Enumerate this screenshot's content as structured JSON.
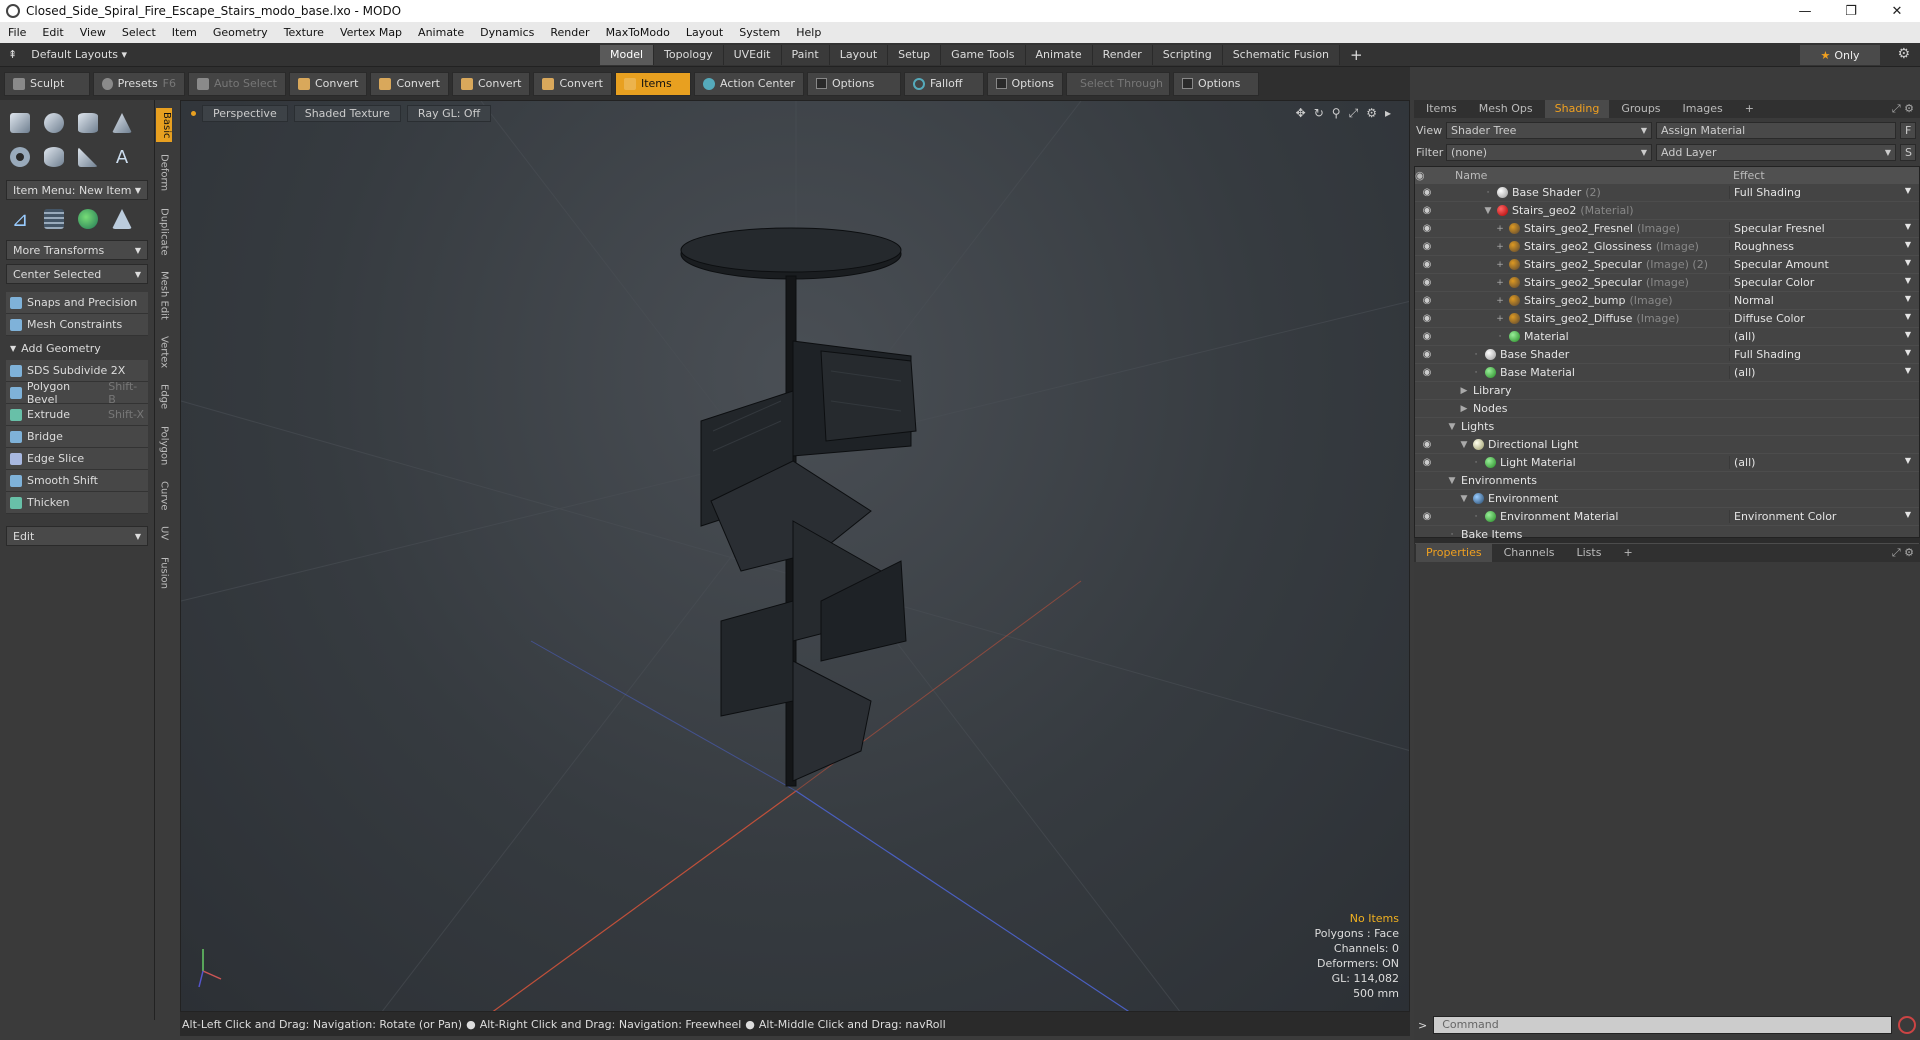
{
  "window": {
    "title": "Closed_Side_Spiral_Fire_Escape_Stairs_modo_base.lxo - MODO",
    "controls": [
      "—",
      "❐",
      "✕"
    ]
  },
  "menu": [
    "File",
    "Edit",
    "View",
    "Select",
    "Item",
    "Geometry",
    "Texture",
    "Vertex Map",
    "Animate",
    "Dynamics",
    "Render",
    "MaxToModo",
    "Layout",
    "System",
    "Help"
  ],
  "layouts": {
    "label": "Default Layouts"
  },
  "tabs": [
    {
      "label": "Model",
      "active": true
    },
    {
      "label": "Topology"
    },
    {
      "label": "UVEdit"
    },
    {
      "label": "Paint"
    },
    {
      "label": "Layout"
    },
    {
      "label": "Setup"
    },
    {
      "label": "Game Tools"
    },
    {
      "label": "Animate"
    },
    {
      "label": "Render"
    },
    {
      "label": "Scripting"
    },
    {
      "label": "Schematic Fusion"
    }
  ],
  "only_label": "Only",
  "toolbar": {
    "sculpt": "Sculpt",
    "presets": "Presets",
    "presets_key": "F6",
    "auto_select": "Auto Select",
    "convert1": "Convert",
    "convert2": "Convert",
    "convert3": "Convert",
    "convert4": "Convert",
    "items": "Items",
    "action_center": "Action Center",
    "options1": "Options",
    "falloff": "Falloff",
    "options2": "Options",
    "select_through": "Select Through",
    "options3": "Options"
  },
  "left": {
    "item_menu": "Item Menu: New Item",
    "more_transforms": "More Transforms",
    "center_selected": "Center Selected",
    "snaps": "Snaps and Precision",
    "mesh_constraints": "Mesh Constraints",
    "add_geometry": "Add Geometry",
    "tools": [
      {
        "label": "SDS Subdivide 2X",
        "shortcut": ""
      },
      {
        "label": "Polygon Bevel",
        "shortcut": "Shift-B"
      },
      {
        "label": "Extrude",
        "shortcut": "Shift-X"
      },
      {
        "label": "Bridge",
        "shortcut": ""
      },
      {
        "label": "Edge Slice",
        "shortcut": ""
      },
      {
        "label": "Smooth Shift",
        "shortcut": ""
      },
      {
        "label": "Thicken",
        "shortcut": ""
      }
    ],
    "edit": "Edit",
    "vtabs": [
      "Basic",
      "Deform",
      "Duplicate",
      "Mesh Edit",
      "Vertex",
      "Edge",
      "Polygon",
      "Curve",
      "UV",
      "Fusion"
    ]
  },
  "viewport": {
    "view": "Perspective",
    "shading": "Shaded Texture",
    "raygl": "Ray GL: Off",
    "info": {
      "no_items": "No Items",
      "polygons": "Polygons : Face",
      "channels": "Channels: 0",
      "deformers": "Deformers: ON",
      "gl": "GL: 114,082",
      "size": "500 mm"
    }
  },
  "status": {
    "hint1": "Alt-Left Click and Drag: Navigation: Rotate (or Pan)",
    "hint2": "Alt-Right Click and Drag: Navigation: Freewheel",
    "hint3": "Alt-Middle Click and Drag: navRoll"
  },
  "right": {
    "tabs": [
      {
        "label": "Items"
      },
      {
        "label": "Mesh Ops"
      },
      {
        "label": "Shading",
        "active": true
      },
      {
        "label": "Groups"
      },
      {
        "label": "Images"
      },
      {
        "label": "+"
      }
    ],
    "view_label": "View",
    "view_value": "Shader Tree",
    "assign": "Assign Material",
    "f_btn": "F",
    "filter_label": "Filter",
    "filter_value": "(none)",
    "add_layer": "Add Layer",
    "s_btn": "S",
    "col_name": "Name",
    "col_effect": "Effect",
    "rows": [
      {
        "name": "Base Shader",
        "sub": "(2)",
        "effect": "Full Shading",
        "ind": 3,
        "ball": "white"
      },
      {
        "name": "Stairs_geo2",
        "sub": "(Material)",
        "effect": "",
        "ind": 3,
        "ball": "red",
        "tw": "▼"
      },
      {
        "name": "Stairs_geo2_Fresnel",
        "sub": "(Image)",
        "effect": "Specular Fresnel",
        "ind": 4,
        "ball": "img",
        "tw": "+"
      },
      {
        "name": "Stairs_geo2_Glossiness",
        "sub": "(Image)",
        "effect": "Roughness",
        "ind": 4,
        "ball": "img",
        "tw": "+"
      },
      {
        "name": "Stairs_geo2_Specular",
        "sub": "(Image) (2)",
        "effect": "Specular Amount",
        "ind": 4,
        "ball": "img",
        "tw": "+"
      },
      {
        "name": "Stairs_geo2_Specular",
        "sub": "(Image)",
        "effect": "Specular Color",
        "ind": 4,
        "ball": "img",
        "tw": "+"
      },
      {
        "name": "Stairs_geo2_bump",
        "sub": "(Image)",
        "effect": "Normal",
        "ind": 4,
        "ball": "img",
        "tw": "+"
      },
      {
        "name": "Stairs_geo2_Diffuse",
        "sub": "(Image)",
        "effect": "Diffuse Color",
        "ind": 4,
        "ball": "img",
        "tw": "+"
      },
      {
        "name": "Material",
        "sub": "",
        "effect": "(all)",
        "ind": 4,
        "ball": "green"
      },
      {
        "name": "Base Shader",
        "sub": "",
        "effect": "Full Shading",
        "ind": 2,
        "ball": "white"
      },
      {
        "name": "Base Material",
        "sub": "",
        "effect": "(all)",
        "ind": 2,
        "ball": "green"
      },
      {
        "name": "Library",
        "sub": "",
        "effect": "",
        "ind": 1,
        "ball": "",
        "tw": "▶",
        "noeye": true
      },
      {
        "name": "Nodes",
        "sub": "",
        "effect": "",
        "ind": 1,
        "ball": "",
        "tw": "▶",
        "noeye": true
      },
      {
        "name": "Lights",
        "sub": "",
        "effect": "",
        "ind": 0,
        "ball": "",
        "tw": "▼",
        "noeye": true
      },
      {
        "name": "Directional Light",
        "sub": "",
        "effect": "",
        "ind": 1,
        "ball": "lamp",
        "tw": "▼"
      },
      {
        "name": "Light Material",
        "sub": "",
        "effect": "(all)",
        "ind": 2,
        "ball": "green"
      },
      {
        "name": "Environments",
        "sub": "",
        "effect": "",
        "ind": 0,
        "ball": "",
        "tw": "▼",
        "noeye": true
      },
      {
        "name": "Environment",
        "sub": "",
        "effect": "",
        "ind": 1,
        "ball": "blue",
        "tw": "▼",
        "noeye": true
      },
      {
        "name": "Environment Material",
        "sub": "",
        "effect": "Environment Color",
        "ind": 2,
        "ball": "green"
      },
      {
        "name": "Bake Items",
        "sub": "",
        "effect": "",
        "ind": 0,
        "ball": "",
        "noeye": true
      }
    ],
    "props_tabs": [
      {
        "label": "Properties",
        "active": true
      },
      {
        "label": "Channels"
      },
      {
        "label": "Lists"
      },
      {
        "label": "+"
      }
    ],
    "command_placeholder": "Command"
  }
}
